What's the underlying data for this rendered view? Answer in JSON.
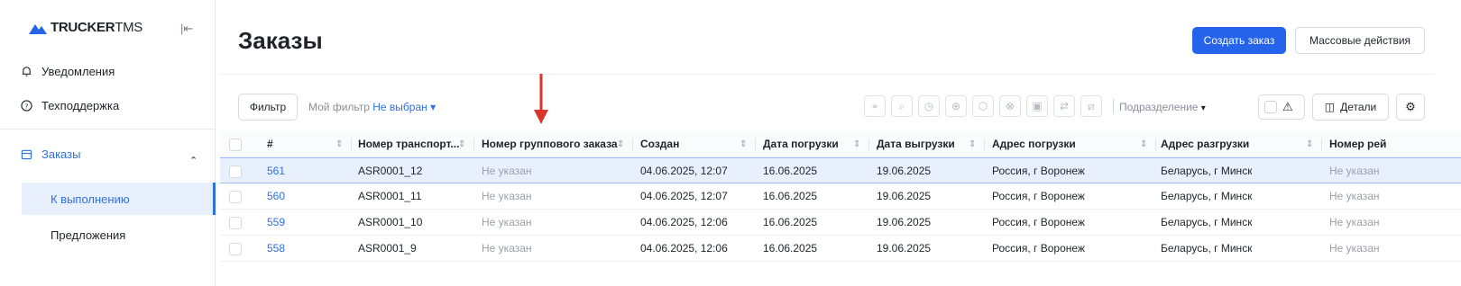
{
  "app": {
    "brand_bold": "TRUCKER",
    "brand_light": "TMS",
    "accent": "#2563eb"
  },
  "sidebar": {
    "items": [
      {
        "label": "Уведомления",
        "icon": "bell-icon"
      },
      {
        "label": "Техподдержка",
        "icon": "help-circle-icon"
      },
      {
        "label": "Заказы",
        "icon": "calendar-icon"
      }
    ],
    "subitems": [
      {
        "label": "К выполнению"
      },
      {
        "label": "Предложения"
      }
    ]
  },
  "header": {
    "title": "Заказы",
    "create_label": "Создать заказ",
    "bulk_label": "Массовые действия"
  },
  "toolbar": {
    "filter_label": "Фильтр",
    "my_filter_label": "Мой фильтр",
    "my_filter_value": "Не выбран",
    "division_label": "Подразделение",
    "details_label": "Детали"
  },
  "table": {
    "columns": [
      "#",
      "Номер транспорт...",
      "Номер группового заказа",
      "Создан",
      "Дата погрузки",
      "Дата выгрузки",
      "Адрес погрузки",
      "Адрес разгрузки",
      "Номер рей"
    ],
    "rows": [
      {
        "id": "561",
        "transport": "ASR0001_12",
        "group": "Не указан",
        "created": "04.06.2025, 12:07",
        "load_date": "16.06.2025",
        "unload_date": "19.06.2025",
        "load_addr": "Россия, г Воронеж",
        "unload_addr": "Беларусь, г Минск",
        "trip": "Не указан"
      },
      {
        "id": "560",
        "transport": "ASR0001_11",
        "group": "Не указан",
        "created": "04.06.2025, 12:07",
        "load_date": "16.06.2025",
        "unload_date": "19.06.2025",
        "load_addr": "Россия, г Воронеж",
        "unload_addr": "Беларусь, г Минск",
        "trip": "Не указан"
      },
      {
        "id": "559",
        "transport": "ASR0001_10",
        "group": "Не указан",
        "created": "04.06.2025, 12:06",
        "load_date": "16.06.2025",
        "unload_date": "19.06.2025",
        "load_addr": "Россия, г Воронеж",
        "unload_addr": "Беларусь, г Минск",
        "trip": "Не указан"
      },
      {
        "id": "558",
        "transport": "ASR0001_9",
        "group": "Не указан",
        "created": "04.06.2025, 12:06",
        "load_date": "16.06.2025",
        "unload_date": "19.06.2025",
        "load_addr": "Россия, г Воронеж",
        "unload_addr": "Беларусь, г Минск",
        "trip": "Не указан"
      }
    ]
  }
}
